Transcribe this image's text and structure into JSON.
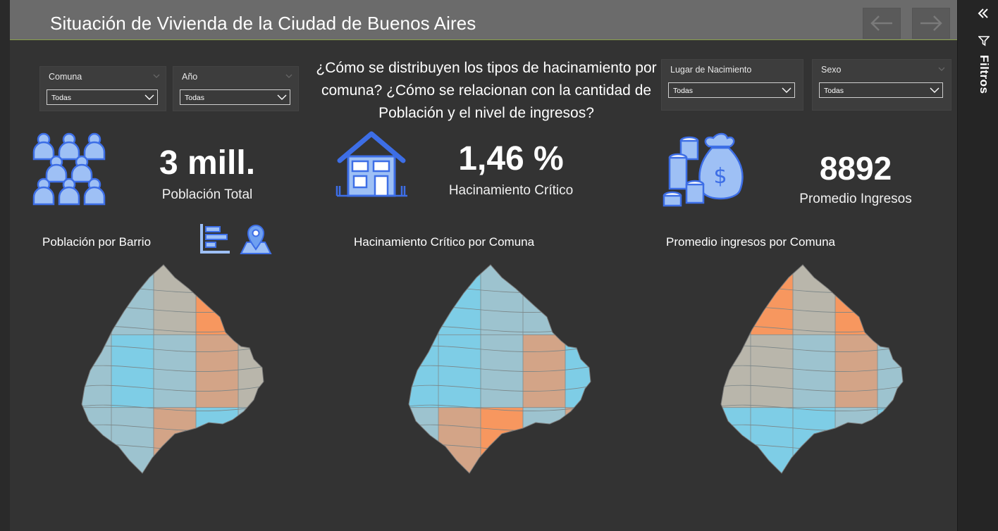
{
  "header": {
    "title": "Situación de Vivienda de la Ciudad de Buenos Aires",
    "back_icon": "arrow-left-icon",
    "forward_icon": "arrow-right-icon"
  },
  "filters": {
    "comuna": {
      "label": "Comuna",
      "value": "Todas"
    },
    "anio": {
      "label": "Año",
      "value": "Todas"
    },
    "lugar_nacimiento": {
      "label": "Lugar de Nacimiento",
      "value": "Todas"
    },
    "sexo": {
      "label": "Sexo",
      "value": "Todas"
    }
  },
  "question": "¿Cómo se distribuyen los tipos de hacinamiento por comuna?  ¿Cómo se relacionan con la cantidad de Población y el nivel de ingresos?",
  "kpis": {
    "poblacion": {
      "value": "3 mill.",
      "label": "Población Total",
      "icon": "people-group-icon"
    },
    "hacinamiento": {
      "value": "1,46 %",
      "label": "Hacinamiento Crítico",
      "icon": "house-icon"
    },
    "ingresos": {
      "value": "8892",
      "label": "Promedio Ingresos",
      "icon": "money-bag-icon"
    }
  },
  "maps": {
    "poblacion": {
      "title": "Población por Barrio"
    },
    "hacinamiento": {
      "title": "Hacinamiento Crítico por Comuna"
    },
    "ingresos": {
      "title": "Promedio ingresos por Comuna"
    }
  },
  "side_pane": {
    "label": "Filtros",
    "collapse_icon": "double-chevron-left-icon",
    "filter_icon": "funnel-icon"
  },
  "colors": {
    "low": "#7ecde6",
    "mid_low": "#9dc3cf",
    "mid": "#b9b6ab",
    "mid_high": "#d3a487",
    "high": "#f7975f"
  }
}
